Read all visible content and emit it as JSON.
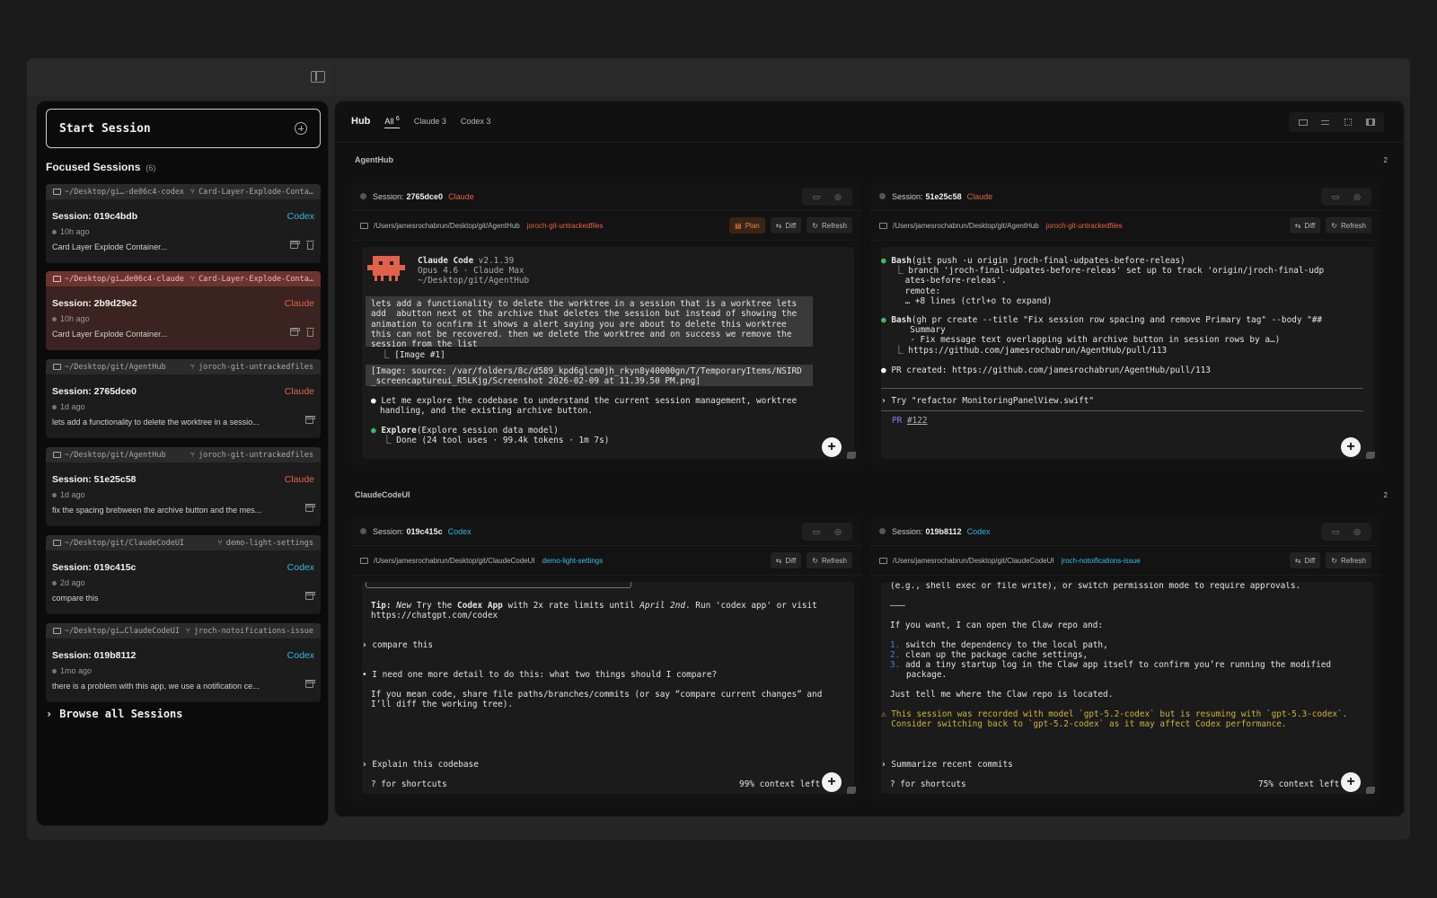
{
  "colors": {
    "claude": "#e2614a",
    "codex": "#2fb7e8",
    "branch_claude": "#e8643f",
    "branch_codex": "#35c0e8",
    "prompt_violet": "#8b7cff",
    "warn": "#d3b23a"
  },
  "sidebar": {
    "start_label": "Start Session",
    "focused_title": "Focused Sessions",
    "focused_count": "(6)",
    "browse_label": "Browse all Sessions",
    "items": [
      {
        "path": "~/Desktop/gi…-de06c4-codex",
        "branch": "Card-Layer-Explode-Conta…",
        "session": "Session: 019c4bdb",
        "provider": "Codex",
        "time": "10h ago",
        "message": "Card Layer Explode Container...",
        "trash": true
      },
      {
        "path": "~/Desktop/gi…de06c4-claude",
        "branch": "Card-Layer-Explode-Conta…",
        "session": "Session: 2b9d29e2",
        "provider": "Claude",
        "time": "10h ago",
        "message": "Card Layer Explode Container...",
        "trash": true
      },
      {
        "path": "~/Desktop/git/AgentHub",
        "branch": "joroch-git-untrackedfiles",
        "session": "Session: 2765dce0",
        "provider": "Claude",
        "time": "1d ago",
        "message": "lets add a functionality to delete the worktree in a sessio...",
        "trash": false
      },
      {
        "path": "~/Desktop/git/AgentHub",
        "branch": "joroch-git-untrackedfiles",
        "session": "Session: 51e25c58",
        "provider": "Claude",
        "time": "1d ago",
        "message": "fix the spacing brebween the archive button and the mes...",
        "trash": false
      },
      {
        "path": "~/Desktop/git/ClaudeCodeUI",
        "branch": "demo-light-settings",
        "session": "Session: 019c415c",
        "provider": "Codex",
        "time": "2d ago",
        "message": "compare this",
        "trash": false
      },
      {
        "path": "~/Desktop/gi…ClaudeCodeUI",
        "branch": "jroch-notoifications-issue",
        "session": "Session: 019b8112",
        "provider": "Codex",
        "time": "1mo ago",
        "message": "there is a problem with this app, we use a notification ce...",
        "trash": false
      }
    ]
  },
  "hub": {
    "title": "Hub",
    "tab_all": "All",
    "tab_all_count": "6",
    "tab_claude": "Claude 3",
    "tab_codex": "Codex 3",
    "groups": [
      {
        "name": "AgentHub",
        "count": "2"
      },
      {
        "name": "ClaudeCodeUI",
        "count": "2"
      }
    ],
    "panels": [
      {
        "session_label": "Session:",
        "session_id": "2765dce0",
        "provider": "Claude",
        "path": "/Users/jamesrochabrun/Desktop/git/AgentHub",
        "branch": "joroch-git-untrackedfiles",
        "plan_label": "Plan",
        "diff_label": "Diff",
        "refresh_label": "Refresh",
        "term": {
          "title": "Claude Code",
          "version": "v2.1.39",
          "model": "Opus 4.6 · Claude Max",
          "cwd": "~/Desktop/git/AgentHub",
          "prompt_lines": [
            "lets add a functionality to delete the worktree in a session that is a worktree lets",
            "add  abutton next ot the archive that deletes the session but instead of showing the",
            "animation to ocnfirm it shows a alert saying you are about to delete this worktree",
            "this can not be recovered. then we delete the worktree and on success we remove the",
            "session from the list",
            "  ⎿ [Image #1]"
          ],
          "image_lines": [
            "[Image: source: /var/folders/8c/d589_kpd6glcm0jh_rkyn8y40000gn/T/TemporaryItems/NSIRD",
            "_screencaptureui_R5LKjg/Screenshot 2026-02-09 at 11.39.50 PM.png]"
          ],
          "reply_lines": [
            "Let me explore the codebase to understand the current session management, worktree",
            "handling, and the existing archive button."
          ],
          "tool_name": "Explore",
          "tool_args": "(Explore session data model)",
          "tool_result": "  ⎿ Done (24 tool uses · 99.4k tokens · 1m 7s)"
        }
      },
      {
        "session_label": "Session:",
        "session_id": "51e25c58",
        "provider": "Claude",
        "path": "/Users/jamesrochabrun/Desktop/git/AgentHub",
        "branch": "joroch-git-untrackedfiles",
        "diff_label": "Diff",
        "refresh_label": "Refresh",
        "term": {
          "bash1_cmd": "(git push -u origin jroch-final-udpates-before-releas)",
          "bash1_out": [
            "  ⎿ branch 'jroch-final-udpates-before-releas' set up to track 'origin/jroch-final-udp",
            "    ates-before-releas'.",
            "    remote:",
            "    … +8 lines (ctrl+o to expand)"
          ],
          "bash2_cmd": "(gh pr create --title \"Fix session row spacing and remove Primary tag\" --body \"##",
          "bash2_out": [
            "     Summary",
            "     - Fix message text overlapping with archive button in session rows by a…)",
            "  ⎿ https://github.com/jamesrochabrun/AgentHub/pull/113"
          ],
          "bash_label": "Bash",
          "pr_line": "PR created: https://github.com/jamesrochabrun/AgentHub/pull/113",
          "input_line": "Try \"refactor MonitoringPanelView.swift\"",
          "pr_tag": "PR",
          "pr_num": "#122"
        }
      },
      {
        "session_label": "Session:",
        "session_id": "019c415c",
        "provider": "Codex",
        "path": "/Users/jamesrochabrun/Desktop/git/ClaudeCodeUI",
        "branch": "demo-light-settings",
        "diff_label": "Diff",
        "refresh_label": "Refresh",
        "term": {
          "tip_label": "Tip:",
          "tip_new": "New",
          "tip_a": " Try the ",
          "tip_app": "Codex App",
          "tip_b": " with 2x rate limits until ",
          "tip_date": "April 2nd",
          "tip_c": ". Run 'codex app' or visit",
          "tip_url": "https://chatgpt.com/codex",
          "user_msg": "compare this",
          "reply_lines": [
            "I need one more detail to do this: what two things should I compare?",
            "",
            "If you mean code, share file paths/branches/commits (or say “compare current changes” and",
            "I’ll diff the working tree)."
          ],
          "input_line": "Explain this codebase",
          "shortcuts": "? for shortcuts",
          "context": "99% context left"
        }
      },
      {
        "session_label": "Session:",
        "session_id": "019b8112",
        "provider": "Codex",
        "path": "/Users/jamesrochabrun/Desktop/git/ClaudeCodeUI",
        "branch": "jroch-notoifications-issue",
        "diff_label": "Diff",
        "refresh_label": "Refresh",
        "term": {
          "top_line": "(e.g., shell exec or file write), or switch permission mode to require approvals.",
          "sep": "———",
          "intro": "If you want, I can open the Claw repo and:",
          "list": [
            "switch the dependency to the local path,",
            "clean up the package cache settings,",
            "add a tiny startup log in the Claw app itself to confirm you’re running the modified",
            "package."
          ],
          "closing": "Just tell me where the Claw repo is located.",
          "warn_lines": [
            "⚠ This session was recorded with model `gpt-5.2-codex` but is resuming with `gpt-5.3-codex`.",
            "  Consider switching back to `gpt-5.2-codex` as it may affect Codex performance."
          ],
          "input_line": "Summarize recent commits",
          "shortcuts": "? for shortcuts",
          "context": "75% context left"
        }
      }
    ]
  }
}
